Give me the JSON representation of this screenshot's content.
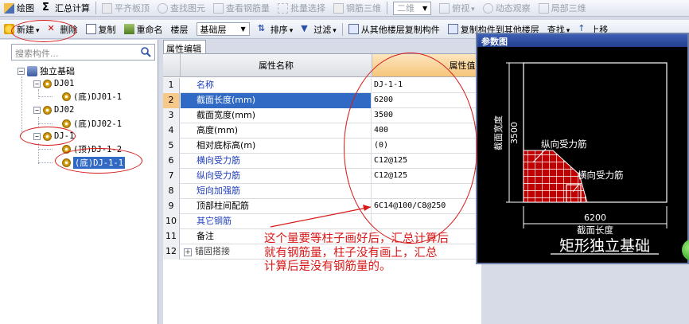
{
  "toolbar1": {
    "draw": "绘图",
    "summary_calc": "汇总计算",
    "flush_slab": "平齐板顶",
    "find_element": "查找图元",
    "view_rebar": "查看钢筋量",
    "batch_select": "批量选择",
    "rebar_3d": "钢筋三维",
    "view_mode": "二维",
    "top_view": "俯视",
    "dynamic_observe": "动态观察",
    "local_3d": "局部三维"
  },
  "toolbar2": {
    "new": "新建",
    "delete": "删除",
    "copy": "复制",
    "rename": "重命名",
    "floor_label": "楼层",
    "floor_value": "基础层",
    "sort": "排序",
    "filter": "过滤",
    "copy_from_floor": "从其他楼层复制构件",
    "copy_to_floor": "复制构件到其他楼层",
    "find": "查找",
    "move_up": "上移"
  },
  "search": {
    "placeholder": "搜索构件..."
  },
  "tree": {
    "root": "独立基础",
    "items": [
      "DJ01",
      "(底)DJ01-1",
      "DJ02",
      "(底)DJ02-1",
      "DJ-1",
      "(顶)DJ-1-2",
      "(底)DJ-1-1"
    ]
  },
  "properties": {
    "tab": "属性编辑",
    "col_name": "属性名称",
    "col_value": "属性值",
    "rows": [
      {
        "no": "1",
        "name": "名称",
        "value": "DJ-1-1"
      },
      {
        "no": "2",
        "name": "截面长度(mm)",
        "value": "6200"
      },
      {
        "no": "3",
        "name": "截面宽度(mm)",
        "value": "3500"
      },
      {
        "no": "4",
        "name": "高度(mm)",
        "value": "400"
      },
      {
        "no": "5",
        "name": "相对底标高(m)",
        "value": "(0)"
      },
      {
        "no": "6",
        "name": "横向受力筋",
        "value": "C12@125"
      },
      {
        "no": "7",
        "name": "纵向受力筋",
        "value": "C12@125"
      },
      {
        "no": "8",
        "name": "短向加强筋",
        "value": ""
      },
      {
        "no": "9",
        "name": "顶部柱间配筋",
        "value": "6C14@100/C8@250"
      },
      {
        "no": "10",
        "name": "其它钢筋",
        "value": ""
      },
      {
        "no": "11",
        "name": "备注",
        "value": ""
      },
      {
        "no": "12",
        "name": "锚固搭接",
        "value": ""
      }
    ]
  },
  "reference": {
    "title": "参数图",
    "width_label": "截面宽度",
    "width_value": "3500",
    "long_rebar": "纵向受力筋",
    "trans_rebar": "横向受力筋",
    "length_value": "6200",
    "length_label": "截面长度",
    "caption": "矩形独立基础"
  },
  "note": {
    "lines": [
      "这个量要等柱子画好后，汇总计算后",
      "就有钢筋量，柱子没有画上，汇总",
      "计算后是没有钢筋量的。"
    ]
  },
  "colors": {
    "annotation": "#d81818",
    "selection": "#316ac5",
    "rebar": "#c00000"
  }
}
